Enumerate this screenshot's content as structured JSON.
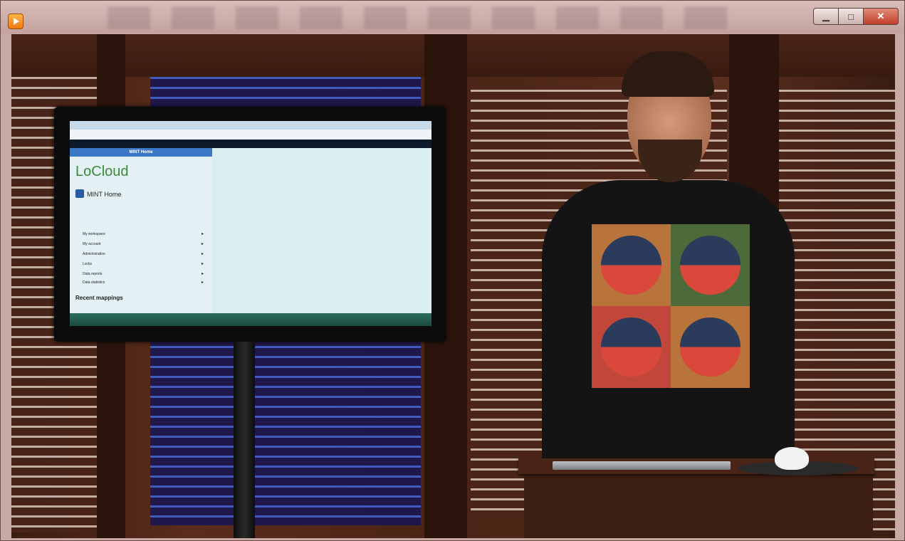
{
  "window": {
    "title": "",
    "icon": "media-player-icon",
    "controls": [
      "minimize-icon",
      "maximize-icon",
      "close-icon"
    ]
  },
  "tv_screen": {
    "app_title": "MINT Home",
    "logo": "LoCloud",
    "home_title": "MINT Home",
    "menu": [
      "My workspace",
      "My account",
      "Administration",
      "Locks",
      "Data reports",
      "Data statistics"
    ],
    "recent_title": "Recent mappings"
  }
}
